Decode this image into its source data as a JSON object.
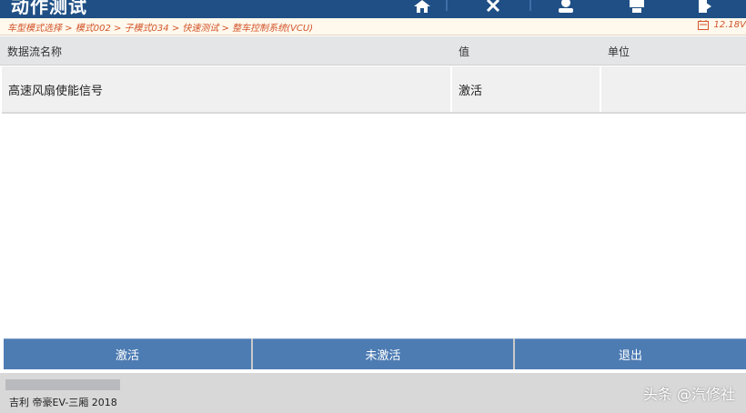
{
  "titlebar": {
    "title": "动作测试",
    "icons": [
      "home-icon",
      "tools-icon",
      "user-icon",
      "print-icon",
      "exit-icon"
    ]
  },
  "breadcrumb": {
    "path": "车型模式选择 > 模式002 > 子模式034 > 快速测试 > 整车控制系统(VCU)",
    "voltage": "12.18V"
  },
  "table": {
    "headers": [
      "数据流名称",
      "值",
      "单位"
    ],
    "rows": [
      {
        "name": "高速风扇使能信号",
        "value": "激活",
        "unit": ""
      }
    ]
  },
  "actions": {
    "activate": "激活",
    "deactivate": "未激活",
    "exit": "退出"
  },
  "statusbar": {
    "vehicle": "吉利 帝豪EV-三厢 2018"
  },
  "watermark": "头条 @汽修社",
  "colors": {
    "titlebar": "#1f4f85",
    "breadcrumb_text": "#d2552b",
    "button": "#4d7cb3"
  }
}
